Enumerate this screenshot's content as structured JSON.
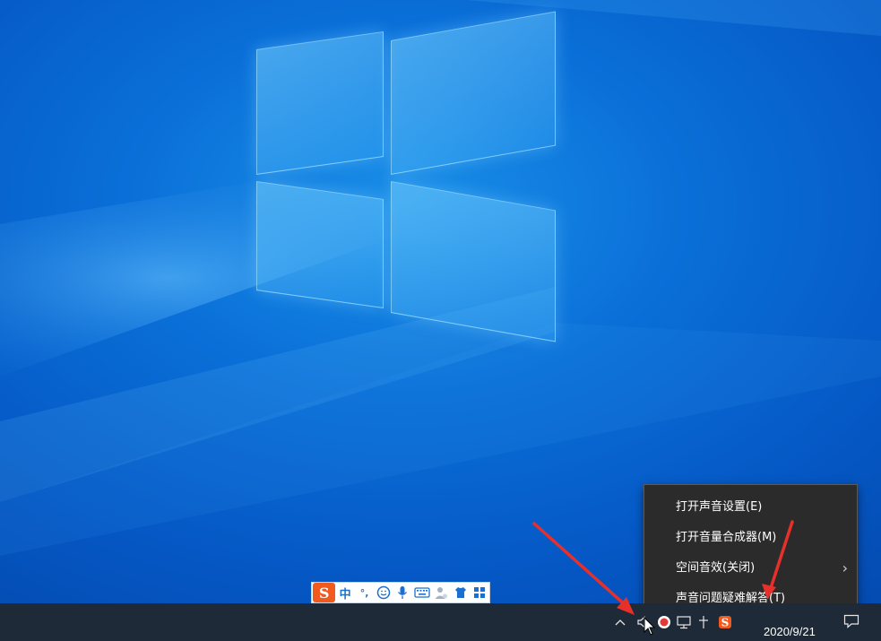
{
  "desktop": {
    "wallpaper": "windows-10-hero"
  },
  "ime_toolbar": {
    "logo": "S",
    "mode": "中",
    "punct": "°,",
    "icons": [
      "emoji-icon",
      "mic-icon",
      "keyboard-icon",
      "user-icon",
      "skin-icon",
      "toolbox-icon"
    ]
  },
  "context_menu": {
    "items": [
      {
        "label": "打开声音设置(E)",
        "has_submenu": false
      },
      {
        "label": "打开音量合成器(M)",
        "has_submenu": false
      },
      {
        "label": "空间音效(关闭)",
        "has_submenu": true
      },
      {
        "label": "声音问题疑难解答(T)",
        "has_submenu": false
      }
    ],
    "submenu_chevron": "›"
  },
  "taskbar": {
    "clock_date": "2020/9/21",
    "tray_icons": [
      "chevron-up-icon",
      "speaker-icon",
      "record-icon",
      "network-icon",
      "pin-icon",
      "sogou-icon",
      "notification-icon"
    ],
    "tray_chevron": "^"
  },
  "annotation_color": "#e8302a"
}
